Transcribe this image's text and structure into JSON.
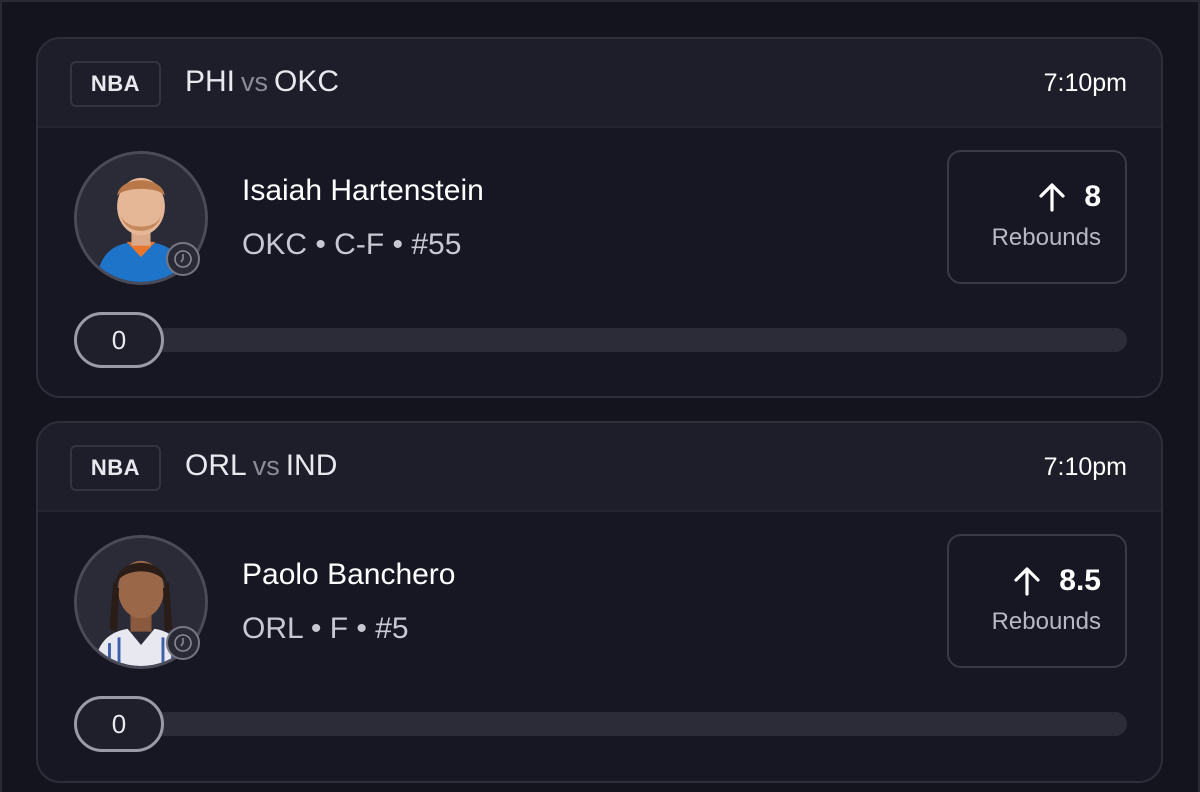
{
  "cards": [
    {
      "league": "NBA",
      "home": "PHI",
      "vs": "vs",
      "away": "OKC",
      "time": "7:10pm",
      "player": {
        "name": "Isaiah Hartenstein",
        "meta": "OKC • C-F • #55",
        "jersey_color": "#1d74c9"
      },
      "stat": {
        "value": "8",
        "label": "Rebounds",
        "direction_icon": "arrow-up-icon"
      },
      "progress": {
        "current": "0",
        "fraction": 0
      }
    },
    {
      "league": "NBA",
      "home": "ORL",
      "vs": "vs",
      "away": "IND",
      "time": "7:10pm",
      "player": {
        "name": "Paolo Banchero",
        "meta": "ORL • F • #5",
        "jersey_color": "#e8e8f0"
      },
      "stat": {
        "value": "8.5",
        "label": "Rebounds",
        "direction_icon": "arrow-up-icon"
      },
      "progress": {
        "current": "0",
        "fraction": 0
      }
    }
  ],
  "colors": {
    "background": "#14141f",
    "card": "#171724",
    "header": "#1e1e2a",
    "track": "#2c2c38"
  }
}
